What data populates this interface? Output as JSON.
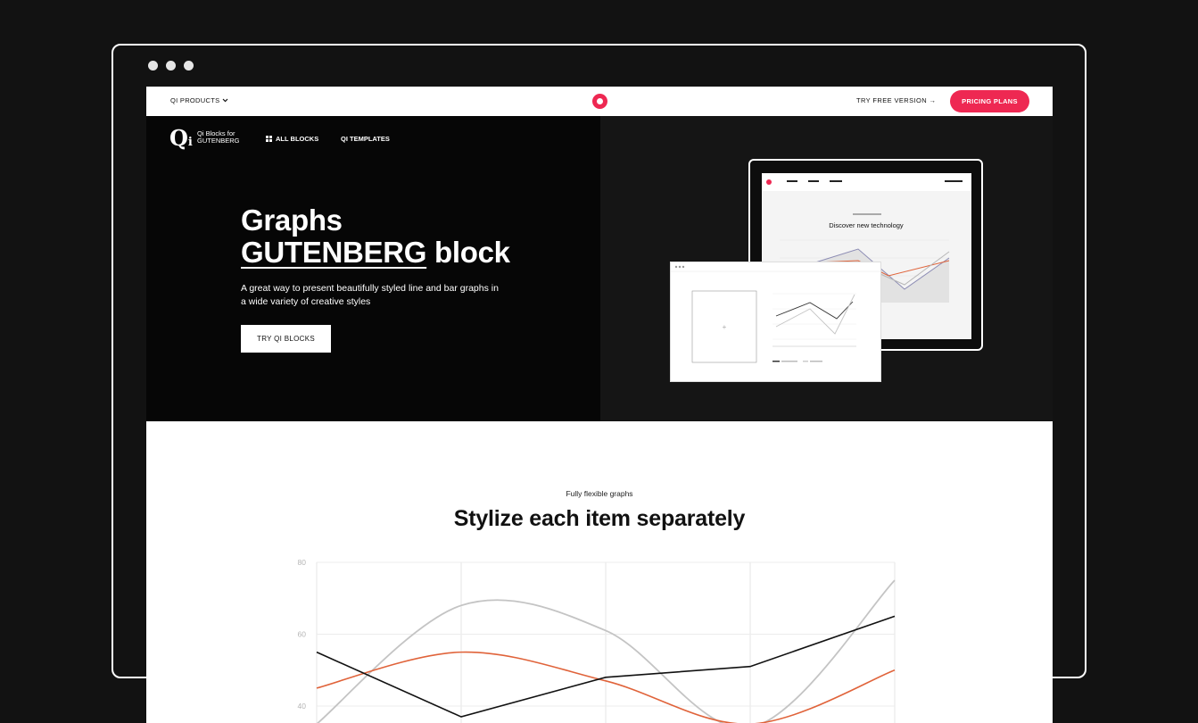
{
  "topnav": {
    "products_label": "QI PRODUCTS",
    "try_free_label": "TRY FREE VERSION →",
    "pricing_label": "PRICING PLANS"
  },
  "hero_nav": {
    "brand_line1": "Qi Blocks for",
    "brand_line2": "GUTENBERG",
    "all_blocks": "ALL BLOCKS",
    "templates": "QI TEMPLATES"
  },
  "hero": {
    "title_line1": "Graphs",
    "title_word_underlined": "GUTENBERG",
    "title_word_rest": " block",
    "subtitle": "A great way to present beautifully styled line and bar graphs in a wide variety of creative styles",
    "cta": "TRY QI BLOCKS"
  },
  "mockup": {
    "tablet_heading": "Discover new technology"
  },
  "section": {
    "eyebrow": "Fully flexible graphs",
    "title": "Stylize each item separately"
  },
  "colors": {
    "accent": "#ee2852",
    "orange_series": "#e0633a",
    "gray_series": "#c4c4c4",
    "black_series": "#111111"
  },
  "chart_data": {
    "type": "line",
    "yticks": [
      80,
      60,
      40
    ],
    "ylim": [
      35,
      80
    ],
    "x": [
      0,
      1,
      2,
      3,
      4
    ],
    "series": [
      {
        "values": [
          55,
          37,
          48,
          51,
          65
        ]
      },
      {
        "values": [
          45,
          55,
          47,
          35,
          50
        ]
      },
      {
        "values": [
          35,
          68,
          61,
          34,
          75
        ]
      }
    ]
  }
}
